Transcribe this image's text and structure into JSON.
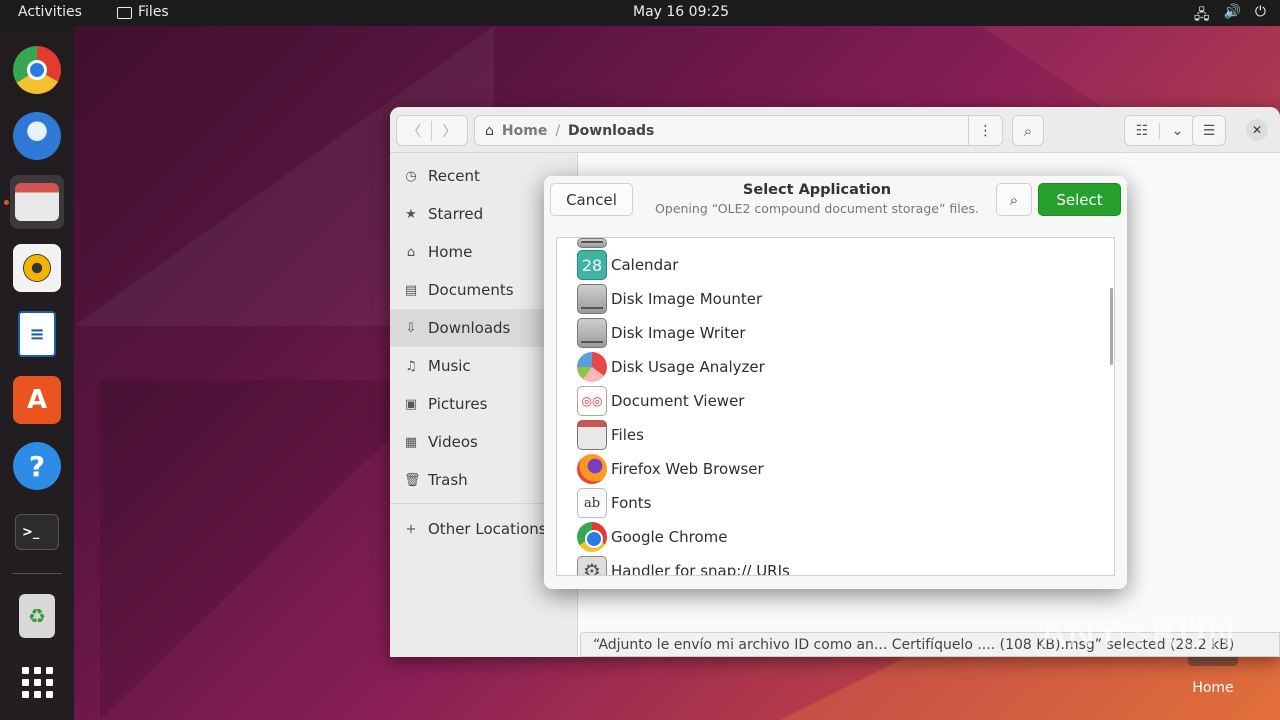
{
  "topbar": {
    "activities": "Activities",
    "app_name": "Files",
    "clock": "May 16  09:25"
  },
  "dock": {
    "apps": [
      "google-chrome",
      "thunderbird",
      "files",
      "rhythmbox",
      "libreoffice-writer",
      "ubuntu-software",
      "help",
      "terminal",
      "trash",
      "show-applications"
    ]
  },
  "files_window": {
    "path_home": "Home",
    "path_separator": "/",
    "path_current": "Downloads",
    "sidebar": [
      {
        "label": "Recent",
        "icon": "clock-icon"
      },
      {
        "label": "Starred",
        "icon": "star-icon"
      },
      {
        "label": "Home",
        "icon": "home-icon"
      },
      {
        "label": "Documents",
        "icon": "document-icon"
      },
      {
        "label": "Downloads",
        "icon": "download-icon",
        "active": true
      },
      {
        "label": "Music",
        "icon": "music-icon"
      },
      {
        "label": "Pictures",
        "icon": "picture-icon"
      },
      {
        "label": "Videos",
        "icon": "video-icon"
      },
      {
        "label": "Trash",
        "icon": "trash-icon"
      }
    ],
    "other_locations": "Other Locations",
    "status": "“Adjunto le envío mi archivo ID como an... Certifíquelo .... (108 KB).msg” selected (28.2 kB)"
  },
  "dialog": {
    "cancel": "Cancel",
    "title": "Select Application",
    "subtitle": "Opening “OLE2 compound document storage” files.",
    "select": "Select",
    "apps": [
      {
        "name": "Calendar",
        "icon": "calendar-icon",
        "icon_text": "28"
      },
      {
        "name": "Disk Image Mounter",
        "icon": "disk-icon"
      },
      {
        "name": "Disk Image Writer",
        "icon": "disk-icon"
      },
      {
        "name": "Disk Usage Analyzer",
        "icon": "disk-usage-icon"
      },
      {
        "name": "Document Viewer",
        "icon": "document-viewer-icon"
      },
      {
        "name": "Files",
        "icon": "files-icon"
      },
      {
        "name": "Firefox Web Browser",
        "icon": "firefox-icon"
      },
      {
        "name": "Fonts",
        "icon": "fonts-icon",
        "icon_text": "ab"
      },
      {
        "name": "Google Chrome",
        "icon": "chrome-icon"
      },
      {
        "name": "Handler for snap:// URIs",
        "icon": "gear-icon",
        "icon_text": "⚙"
      }
    ]
  },
  "desktop": {
    "home_label": "Home",
    "watermark": "ANY▷RUN"
  },
  "colors": {
    "accent_select": "#26a12e",
    "ubuntu_orange": "#e95420",
    "topbar": "#1c1c1c"
  }
}
